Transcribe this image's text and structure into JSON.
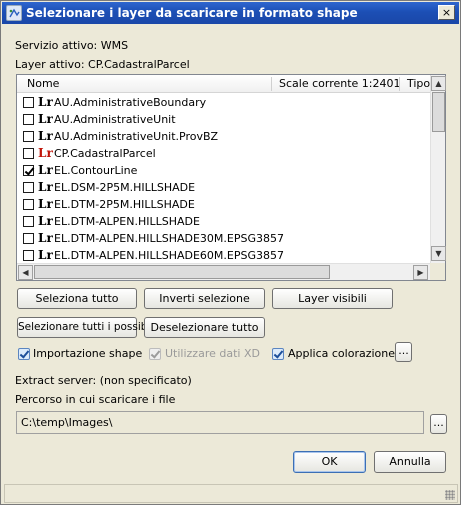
{
  "window": {
    "title": "Selezionare i layer da scaricare in formato shape",
    "close_label": "×"
  },
  "service": "Servizio attivo: WMS",
  "active_layer": "Layer attivo: CP.CadastralParcel",
  "table": {
    "columns": [
      "Nome",
      "Scale corrente 1:2401",
      "Tipo"
    ],
    "rows": [
      {
        "name": "AU.AdministrativeBoundary",
        "checked": false,
        "active": false
      },
      {
        "name": "AU.AdministrativeUnit",
        "checked": false,
        "active": false
      },
      {
        "name": "AU.AdministrativeUnit.ProvBZ",
        "checked": false,
        "active": false
      },
      {
        "name": "CP.CadastralParcel",
        "checked": false,
        "active": true
      },
      {
        "name": "EL.ContourLine",
        "checked": true,
        "active": false
      },
      {
        "name": "EL.DSM-2P5M.HILLSHADE",
        "checked": false,
        "active": false
      },
      {
        "name": "EL.DTM-2P5M.HILLSHADE",
        "checked": false,
        "active": false
      },
      {
        "name": "EL.DTM-ALPEN.HILLSHADE",
        "checked": false,
        "active": false
      },
      {
        "name": "EL.DTM-ALPEN.HILLSHADE30M.EPSG3857",
        "checked": false,
        "active": false
      },
      {
        "name": "EL.DTM-ALPEN.HILLSHADE60M.EPSG3857",
        "checked": false,
        "active": false
      }
    ],
    "layer_icon_text": "Lr"
  },
  "buttons": {
    "select_all": "Seleziona tutto",
    "invert": "Inverti selezione",
    "visible": "Layer visibili",
    "select_possible": "Selezionare tutti i possibili",
    "deselect_all": "Deselezionare tutto",
    "more": "...",
    "browse": "...",
    "ok": "OK",
    "cancel": "Annulla"
  },
  "options": {
    "import_shape": {
      "label": "Importazione shape",
      "checked": true,
      "enabled": true
    },
    "use_xd": {
      "label": "Utilizzare dati XD",
      "checked": true,
      "enabled": false
    },
    "apply_color": {
      "label": "Applica colorazione",
      "checked": true,
      "enabled": true
    }
  },
  "extract_server": "Extract server: (non specificato)",
  "path_label": "Percorso in cui scaricare i file",
  "path_value": "C:\\temp\\Images\\",
  "colors": {
    "titlebar": "#1c4fb5",
    "active_layer_icon": "#c0150a"
  }
}
